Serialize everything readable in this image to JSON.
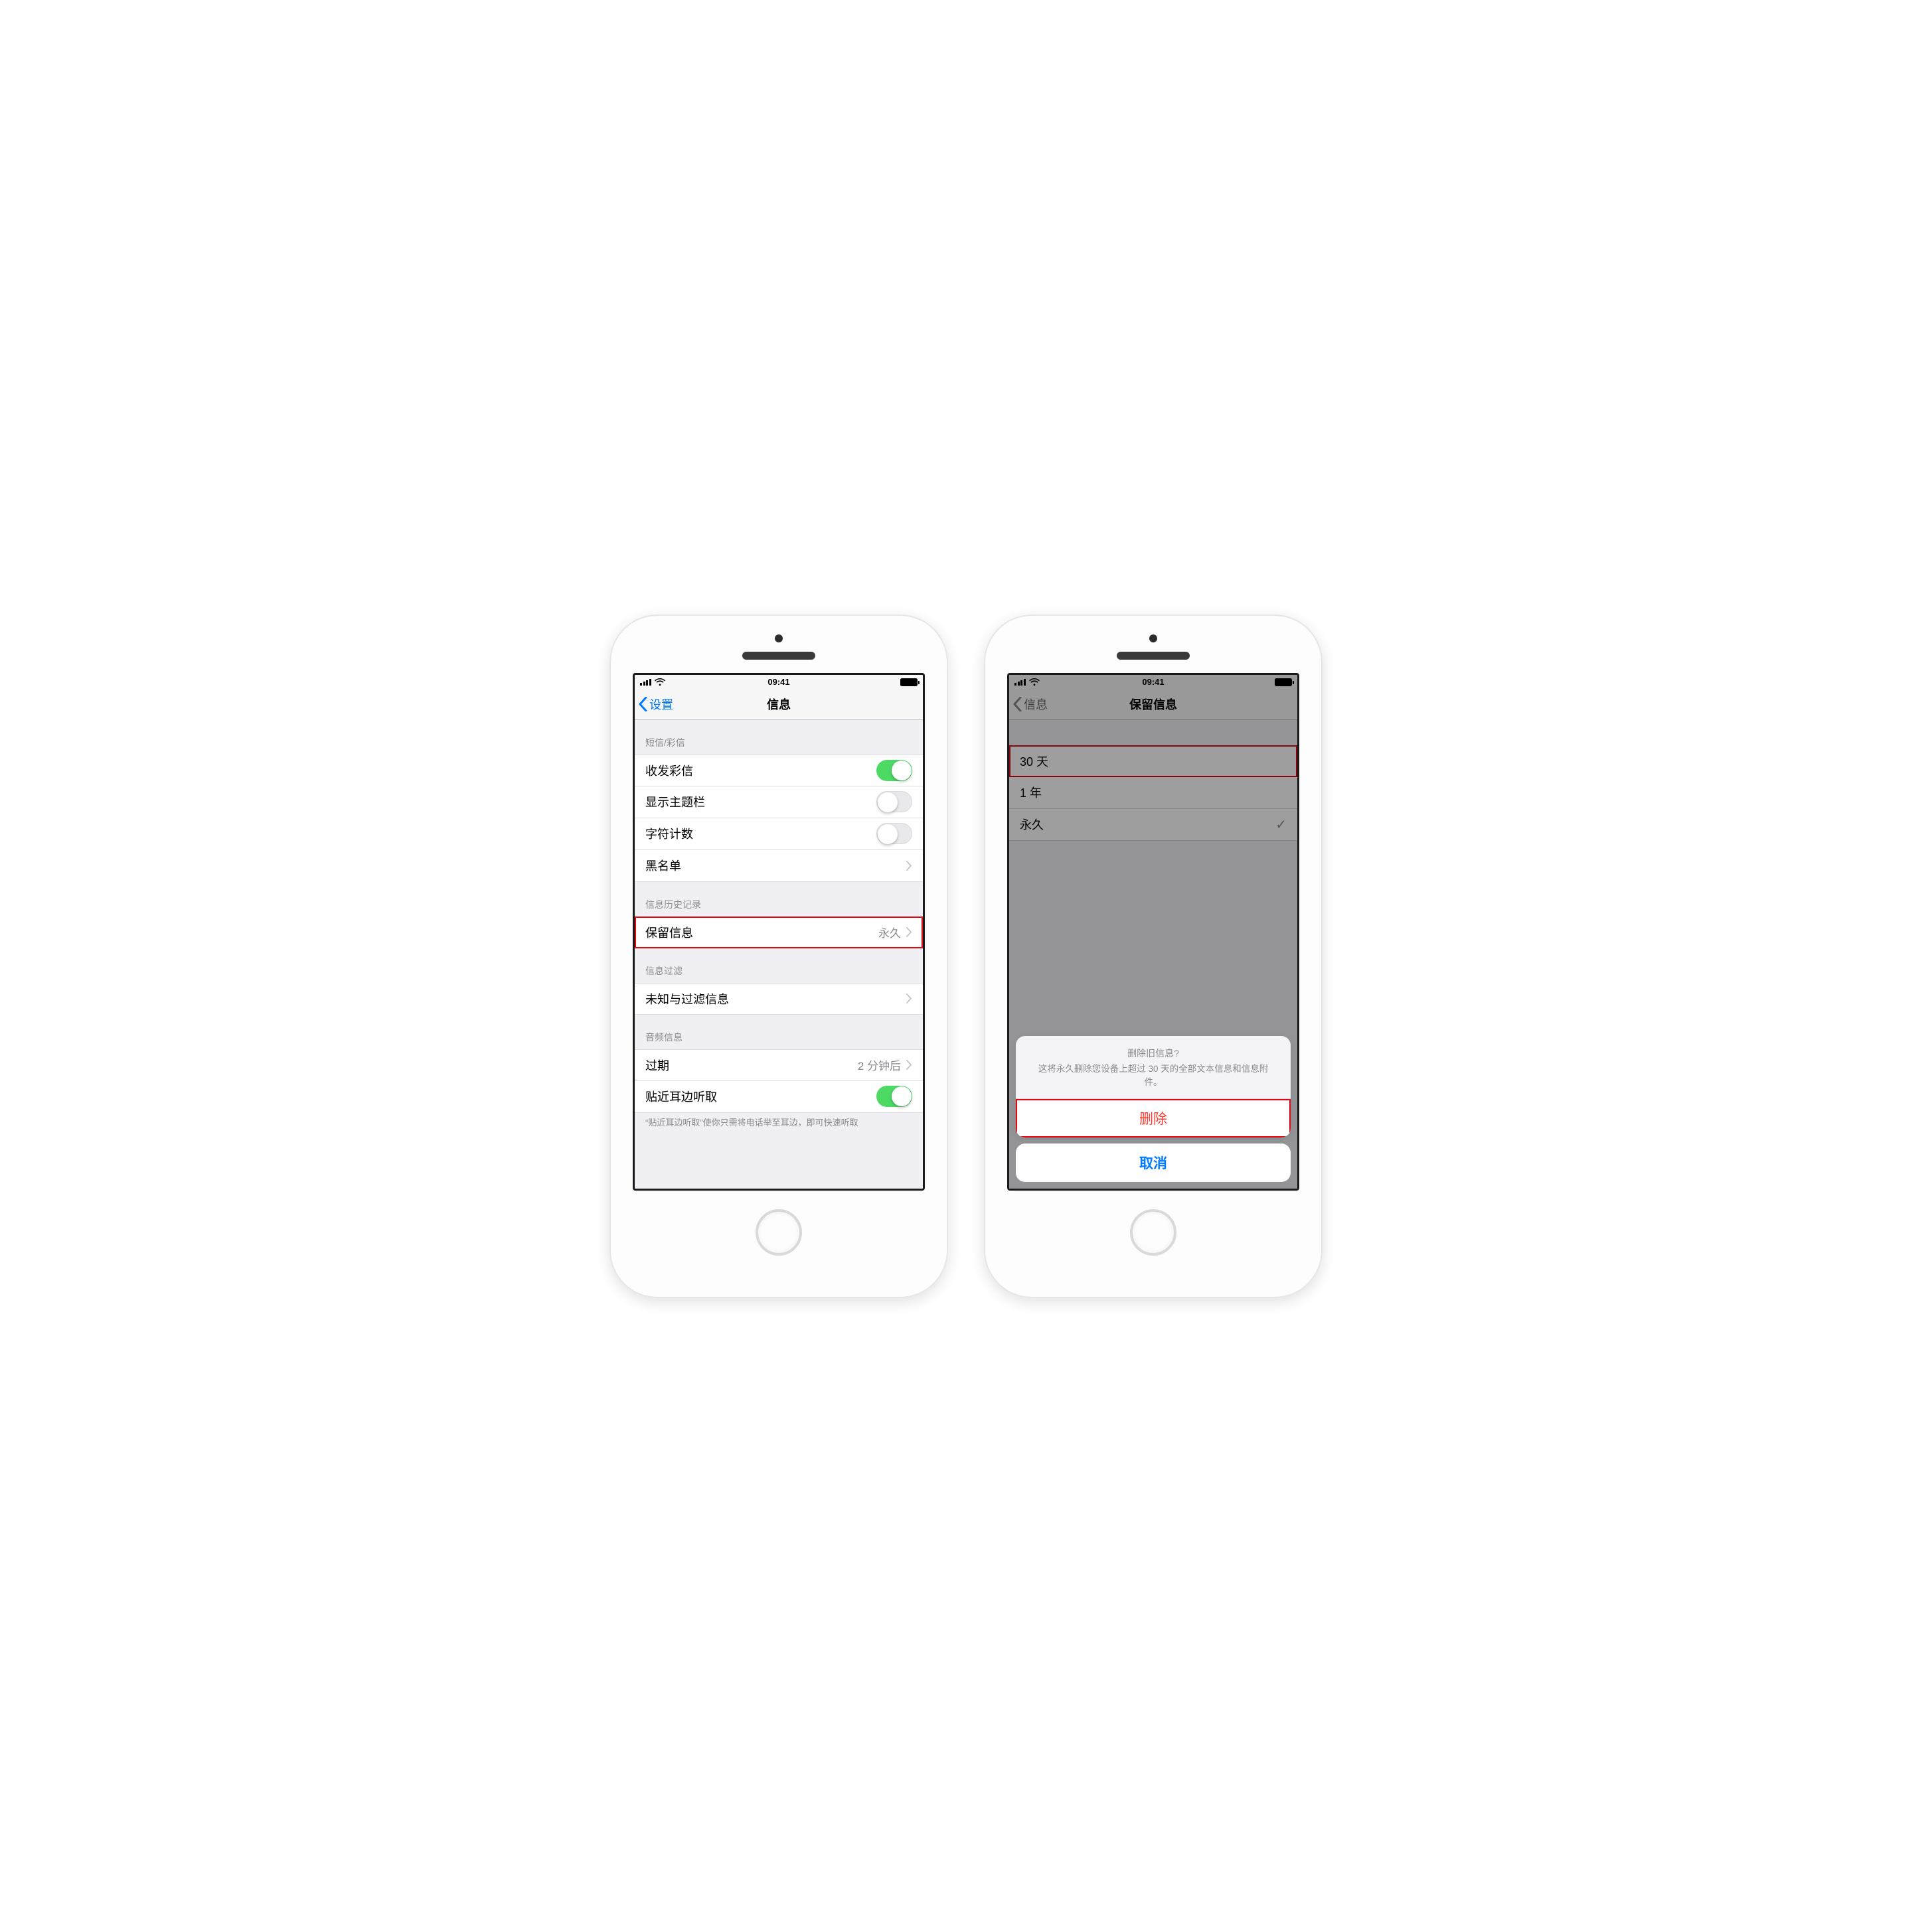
{
  "status": {
    "time": "09:41"
  },
  "left": {
    "nav": {
      "back": "设置",
      "title": "信息"
    },
    "sec1": {
      "header": "短信/彩信",
      "rows": {
        "mms": "收发彩信",
        "subject": "显示主题栏",
        "charcount": "字符计数",
        "blacklist": "黑名单"
      }
    },
    "sec2": {
      "header": "信息历史记录",
      "keep_label": "保留信息",
      "keep_value": "永久"
    },
    "sec3": {
      "header": "信息过滤",
      "filter_label": "未知与过滤信息"
    },
    "sec4": {
      "header": "音频信息",
      "expire_label": "过期",
      "expire_value": "2 分钟后",
      "raise_label": "贴近耳边听取",
      "footer": "“贴近耳边听取”使你只需将电话举至耳边，即可快速听取"
    }
  },
  "right": {
    "nav": {
      "back": "信息",
      "title": "保留信息"
    },
    "options": {
      "opt30": "30 天",
      "opt1y": "1 年",
      "opt_forever": "永久"
    },
    "sheet": {
      "title": "删除旧信息?",
      "desc": "这将永久删除您设备上超过 30 天的全部文本信息和信息附件。",
      "delete": "删除",
      "cancel": "取消"
    }
  }
}
